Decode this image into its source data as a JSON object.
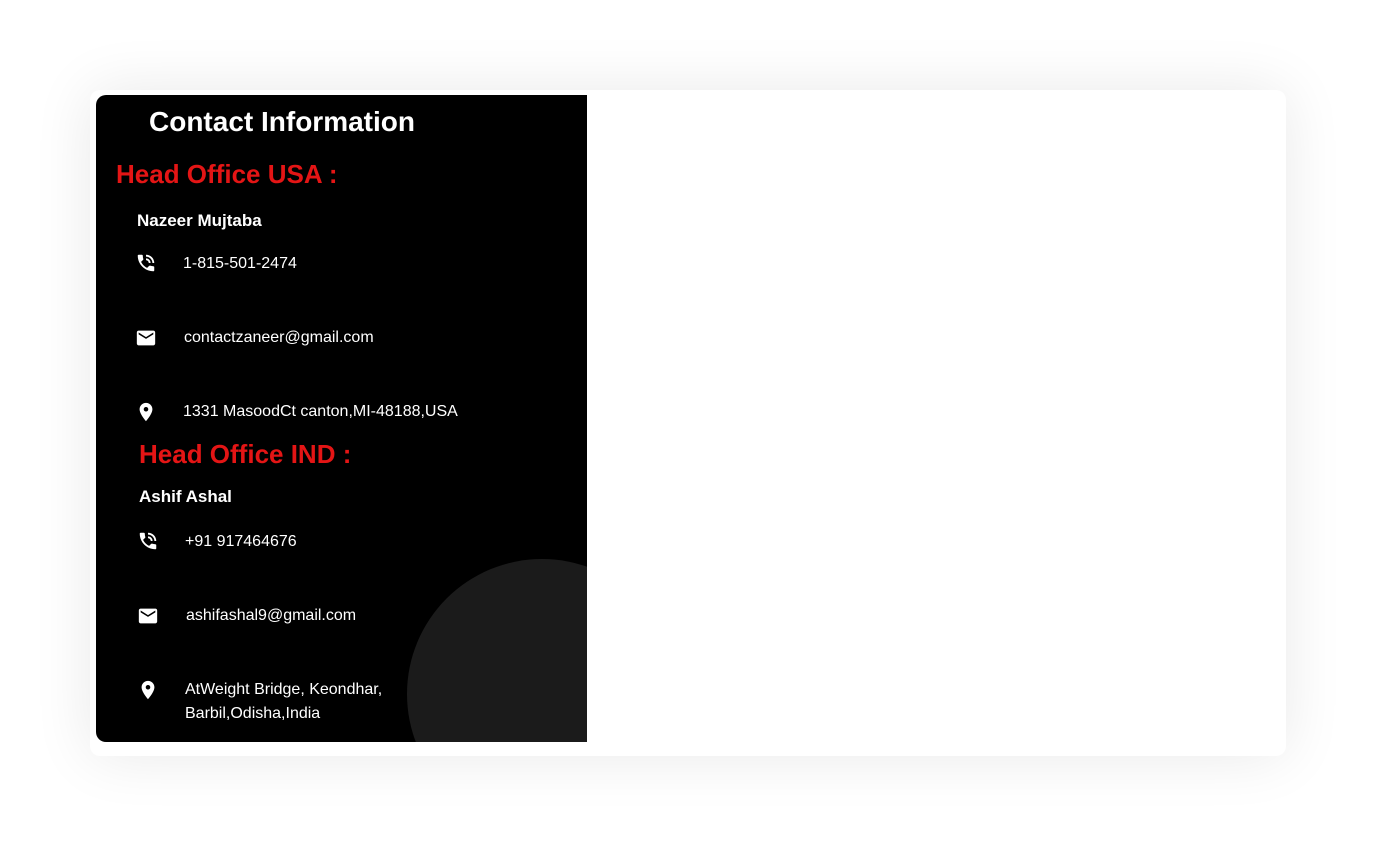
{
  "title": "Contact Information",
  "offices": [
    {
      "heading": "Head Office USA :",
      "name": "Nazeer Mujtaba",
      "phone": "1-815-501-2474",
      "email": "contactzaneer@gmail.com",
      "address": "1331 MasoodCt canton,MI-48188,USA"
    },
    {
      "heading": "Head Office IND :",
      "name": "Ashif Ashal",
      "phone": "+91 917464676",
      "email": "ashifashal9@gmail.com",
      "address_line1": "AtWeight Bridge, Keondhar,",
      "address_line2": "Barbil,Odisha,India"
    }
  ],
  "icons": {
    "phone": "phone-icon",
    "email": "mail-icon",
    "location": "location-pin-icon"
  },
  "colors": {
    "panel_bg": "#000000",
    "heading_accent": "#e41515",
    "text": "#ffffff",
    "decor_circle": "#1b1b1b"
  }
}
